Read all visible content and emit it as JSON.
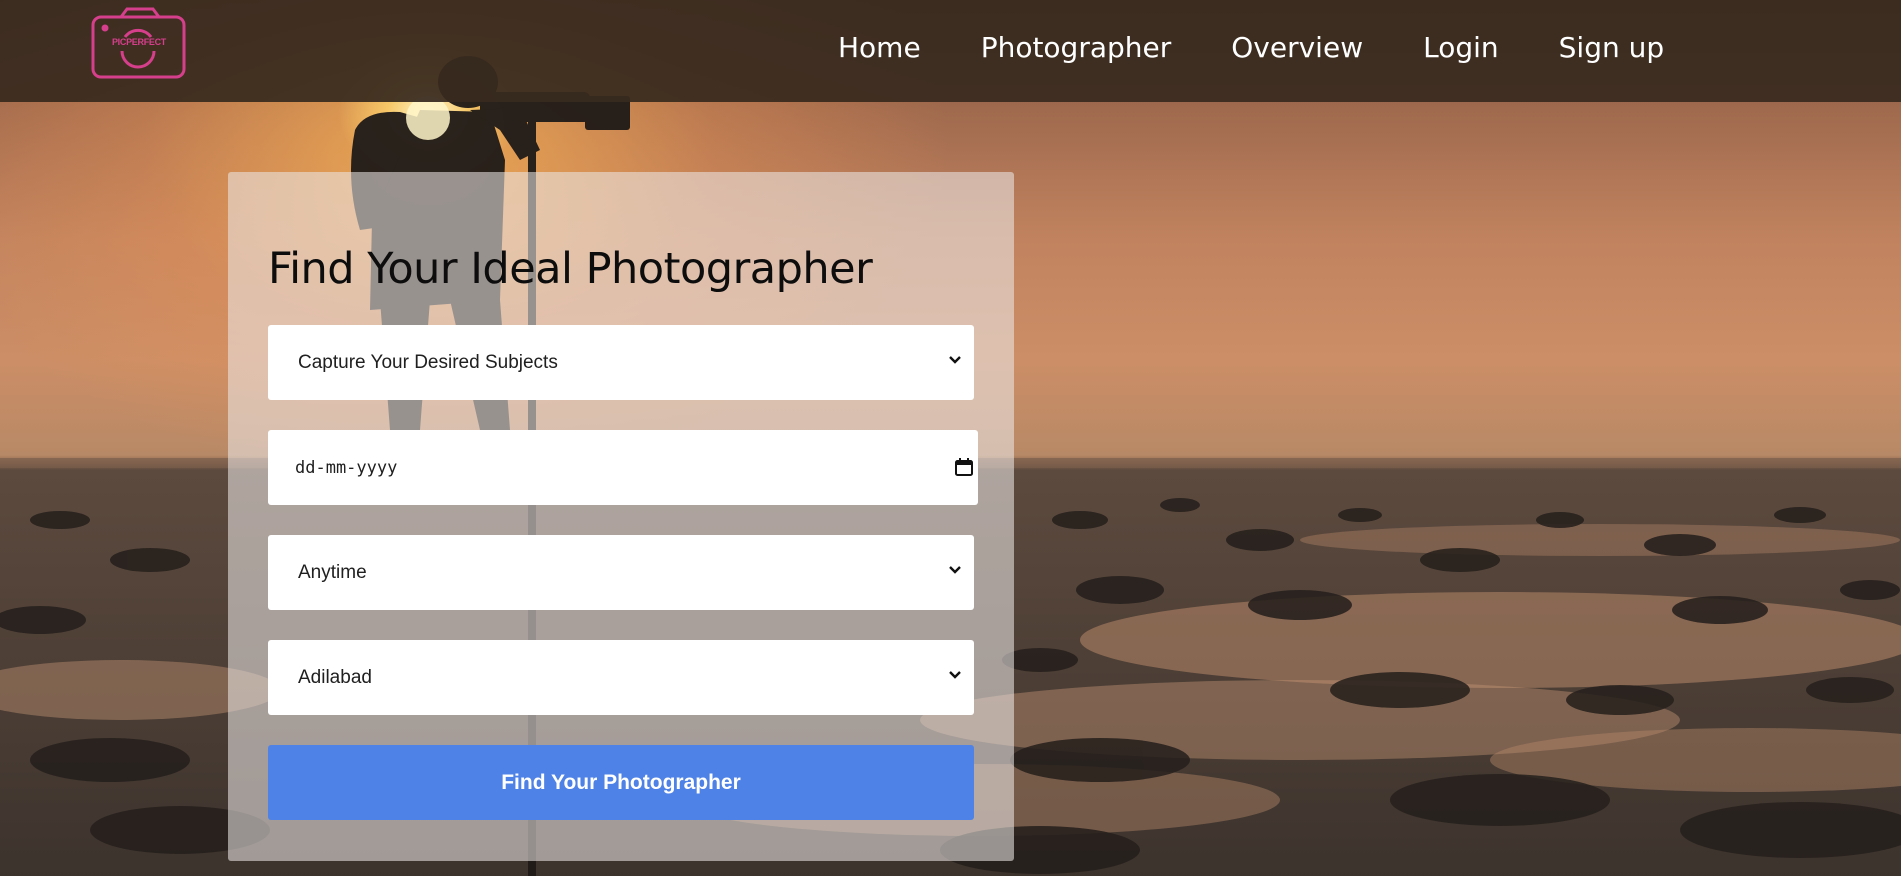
{
  "brand": {
    "logo_text": "PICPERFECT",
    "accent": "#d63f8c"
  },
  "nav": {
    "items": [
      {
        "label": "Home"
      },
      {
        "label": "Photographer"
      },
      {
        "label": "Overview"
      },
      {
        "label": "Login"
      },
      {
        "label": "Sign up"
      }
    ]
  },
  "form": {
    "title": "Find Your Ideal Photographer",
    "subject_select": {
      "selected": "Capture Your Desired Subjects"
    },
    "date_input": {
      "placeholder": "dd-mm-yyyy"
    },
    "time_select": {
      "selected": "Anytime"
    },
    "city_select": {
      "selected": "Adilabad"
    },
    "submit_label": "Find Your Photographer",
    "submit_color": "#4f82e6"
  },
  "icons": [
    "camera-logo-icon",
    "chevron-down-icon",
    "calendar-icon"
  ]
}
